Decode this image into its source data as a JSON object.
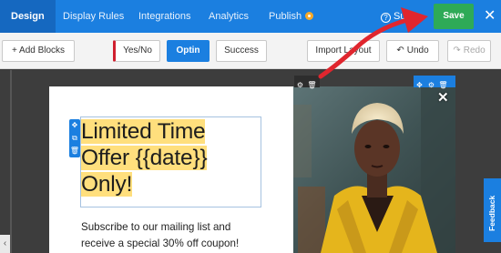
{
  "nav": {
    "tabs": [
      {
        "label": "Design"
      },
      {
        "label": "Display Rules"
      },
      {
        "label": "Integrations"
      },
      {
        "label": "Analytics"
      },
      {
        "label": "Publish"
      }
    ],
    "support_label": "Supp",
    "save_label": "Save",
    "close_glyph": "✕"
  },
  "toolbar": {
    "add_blocks_label": "+ Add Blocks",
    "views": [
      "Yes/No",
      "Optin",
      "Success"
    ],
    "active_view": "Optin",
    "import_label": "Import Layout",
    "undo_label": "Undo",
    "redo_label": "Redo"
  },
  "popup": {
    "headline_line1": "Limited Time",
    "headline_line2": "Offer {{date}}",
    "headline_line3": "Only!",
    "body_text": "Subscribe to our mailing list and receive a special 30% off coupon!"
  },
  "feedback_label": "Feedback",
  "colors": {
    "brand_blue": "#1b7fe0",
    "save_green": "#2eaa57",
    "highlight_yellow": "#ffdf7d",
    "arrow_red": "#e0262e",
    "publish_badge": "#f7a928"
  },
  "icons": {
    "support": "question-circle-icon",
    "undo": "undo-icon",
    "redo": "redo-icon",
    "block_move": "move-icon",
    "block_copy": "copy-icon",
    "block_delete": "trash-icon",
    "settings": "gear-icon"
  }
}
